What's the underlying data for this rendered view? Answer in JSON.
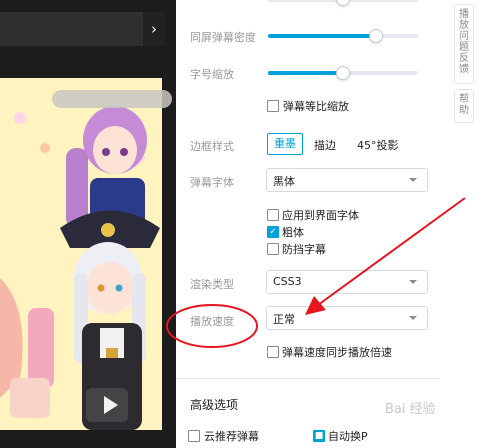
{
  "settings": {
    "density_label": "同屏弹幕密度",
    "density_level": 0.72,
    "fontsize_label": "字号缩放",
    "fontsize_level": 0.5,
    "proportional_label": "弹幕等比缩放",
    "border_label": "边框样式",
    "border_options": [
      "重墨",
      "描边",
      "45°投影"
    ],
    "border_selected": "重墨",
    "font_label": "弹幕字体",
    "font_value": "黑体",
    "use_ui_font": "应用到界面字体",
    "bold": "粗体",
    "block_subtitle": "防挡字幕",
    "render_label": "渲染类型",
    "render_value": "CSS3",
    "speed_label": "播放速度",
    "speed_value": "正常",
    "sync_speed": "弹幕速度同步播放倍速",
    "advanced_title": "高级选项",
    "cloud_recommend": "云推荐弹幕",
    "auto_next": "自动换P"
  },
  "side": {
    "feedback": "播放问题反馈",
    "help": "帮助"
  },
  "colors": {
    "accent": "#00a1d6",
    "annotation": "#e8141e"
  },
  "watermark": "Bai 经验"
}
